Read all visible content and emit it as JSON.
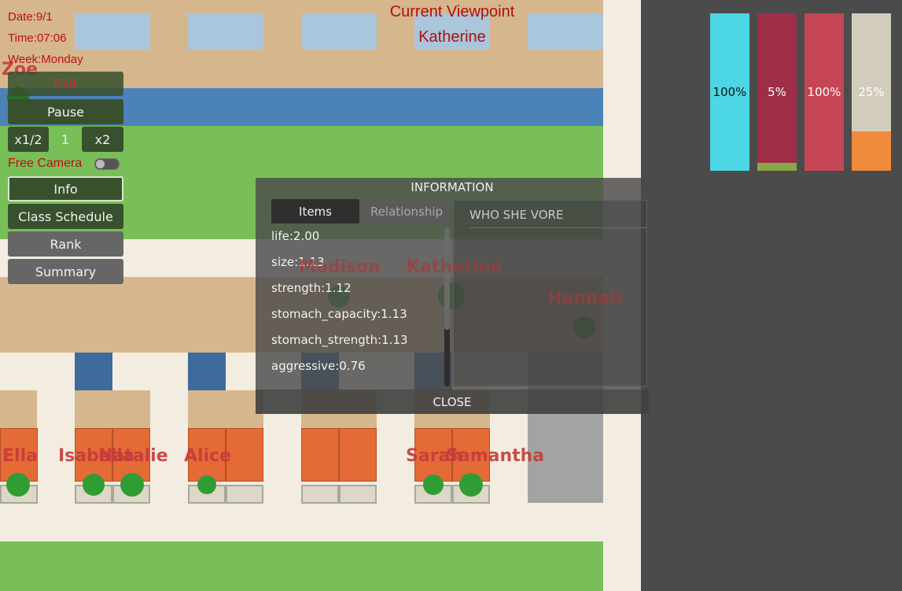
{
  "hud": {
    "date": "Date:9/1",
    "time": "Time:07:06",
    "week": "Week:Monday",
    "viewpoint_label": "Current Viewpoint",
    "viewpoint_name": "Katherine",
    "free_camera_label": "Free Camera",
    "free_camera_on": false
  },
  "buttons": {
    "exit": "Exit",
    "pause": "Pause",
    "slower": "x1/2",
    "speed": "1",
    "faster": "x2",
    "info": "Info",
    "class_schedule": "Class Schedule",
    "rank": "Rank",
    "summary": "Summary"
  },
  "characters": {
    "zoe": "Zoe",
    "madison": "Madison",
    "katherine": "Katherine",
    "hannah": "Hannah",
    "ella": "Ella",
    "isabella": "Isabella",
    "natalie": "Natalie",
    "alice": "Alice",
    "sarah": "Sarah",
    "samantha": "Samantha"
  },
  "status_bars": [
    {
      "label": "100%",
      "level": 1.0,
      "color": "#4dd6e3",
      "back": "#4dd6e3"
    },
    {
      "label": "5%",
      "level": 0.05,
      "color": "#8aa64a",
      "back": "#9e2e46"
    },
    {
      "label": "100%",
      "level": 1.0,
      "color": "#c64555",
      "back": "#c64555"
    },
    {
      "label": "25%",
      "level": 0.25,
      "color": "#f08a3c",
      "back": "#d2ccbc"
    }
  ],
  "info_panel": {
    "title": "INFORMATION",
    "tab_items": "Items",
    "tab_relationship": "Relationship",
    "vore_header": "WHO SHE VORE",
    "stats": [
      "life:2.00",
      "size:1.13",
      "strength:1.12",
      "stomach_capacity:1.13",
      "stomach_strength:1.13",
      "aggressive:0.76"
    ],
    "close": "CLOSE"
  }
}
